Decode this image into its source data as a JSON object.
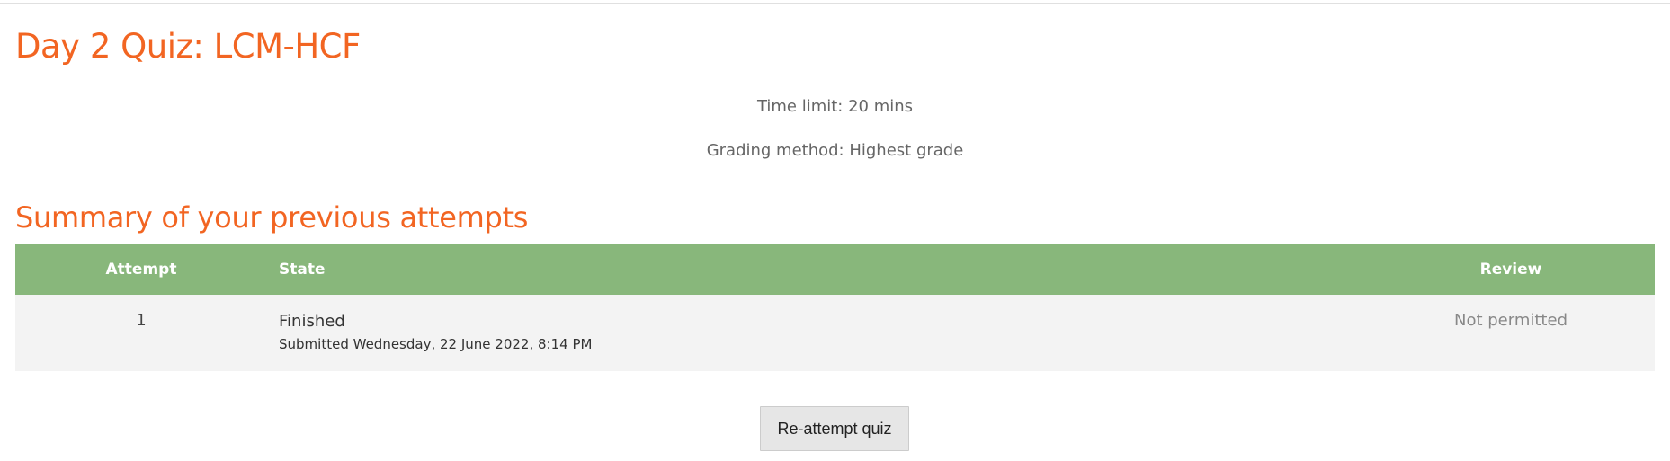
{
  "quiz": {
    "title": "Day 2 Quiz: LCM-HCF",
    "time_limit": "Time limit: 20 mins",
    "grading_method": "Grading method: Highest grade"
  },
  "summary": {
    "heading": "Summary of your previous attempts",
    "columns": {
      "attempt": "Attempt",
      "state": "State",
      "review": "Review"
    },
    "rows": [
      {
        "attempt": "1",
        "state": "Finished",
        "submitted": "Submitted Wednesday, 22 June 2022, 8:14 PM",
        "review": "Not permitted"
      }
    ]
  },
  "actions": {
    "reattempt_label": "Re-attempt quiz"
  },
  "colors": {
    "heading": "#f26522",
    "table_header_bg": "#88b77b",
    "table_row_bg": "#f3f3f3",
    "button_bg": "#e6e6e6"
  }
}
